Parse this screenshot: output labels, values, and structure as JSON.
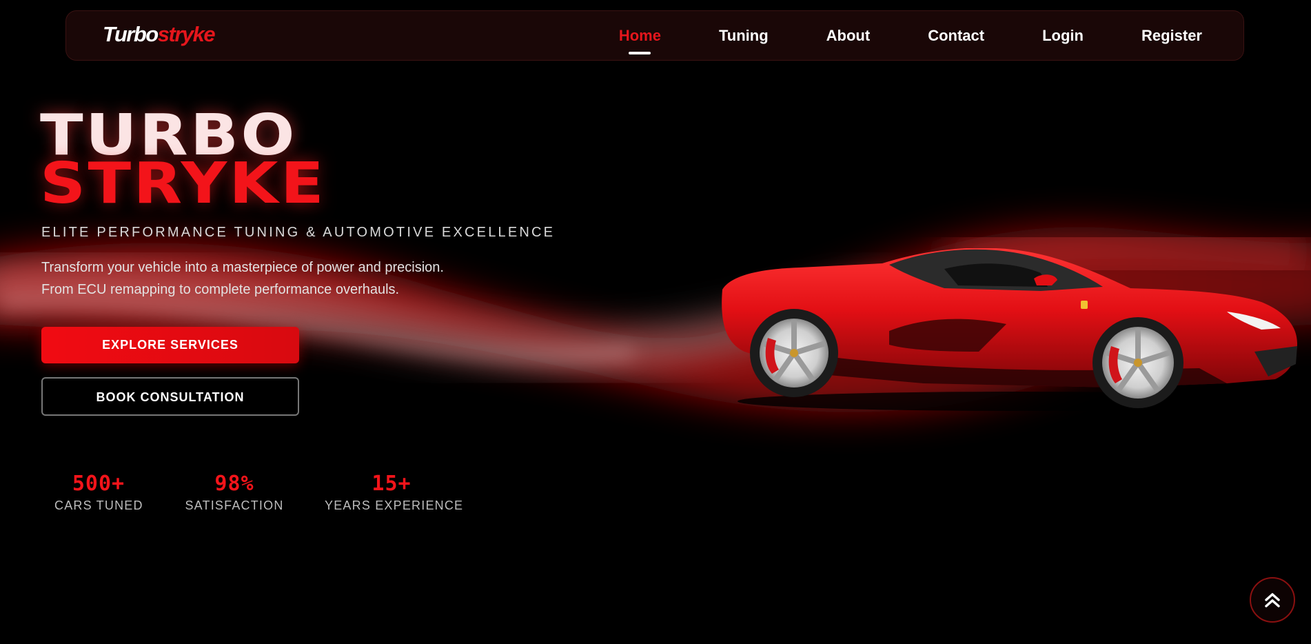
{
  "navbar": {
    "logo_part1": "Turbo",
    "logo_part2": "stryke",
    "links": [
      {
        "label": "Home",
        "active": true
      },
      {
        "label": "Tuning"
      },
      {
        "label": "About"
      },
      {
        "label": "Contact"
      },
      {
        "label": "Login"
      },
      {
        "label": "Register"
      }
    ]
  },
  "hero": {
    "title_line1": "TURBO",
    "title_line2": "STRYKE",
    "subtitle": "ELITE PERFORMANCE TUNING & AUTOMOTIVE EXCELLENCE",
    "description_line1": "Transform your vehicle into a masterpiece of power and precision.",
    "description_line2": "From ECU remapping to complete performance overhauls.",
    "primary_button": "EXPLORE SERVICES",
    "secondary_button": "BOOK CONSULTATION"
  },
  "stats": [
    {
      "value": "500+",
      "label": "CARS TUNED"
    },
    {
      "value": "98%",
      "label": "SATISFACTION"
    },
    {
      "value": "15+",
      "label": "YEARS EXPERIENCE"
    }
  ],
  "icons": {
    "scroll_top": "double-chevron-up-icon"
  },
  "colors": {
    "accent": "#e5161c",
    "background": "#000000",
    "navbar_bg": "#1a0707"
  }
}
